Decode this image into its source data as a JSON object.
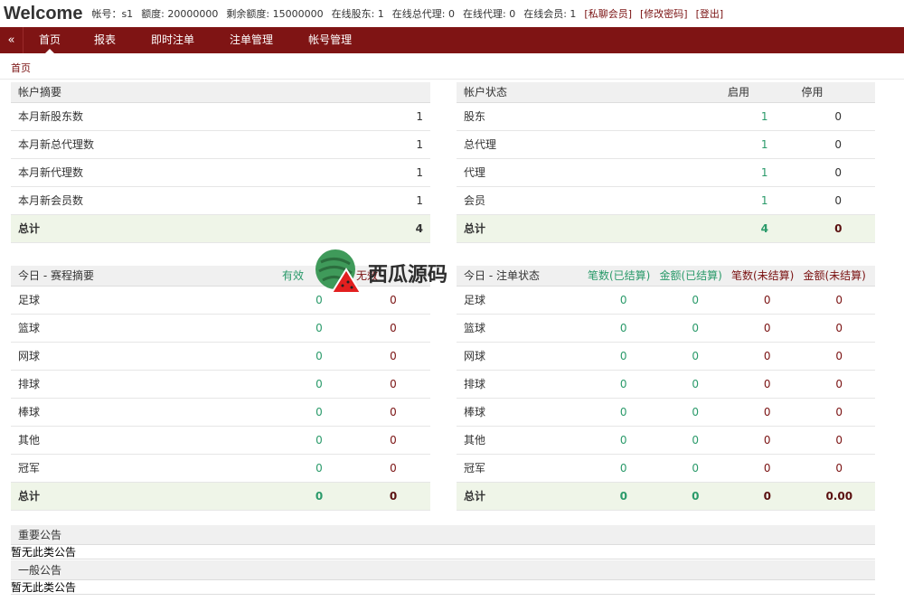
{
  "header": {
    "brand": "Welcome",
    "account": "帐号：s1",
    "credit": "额度: 20000000",
    "remaining": "剩余额度: 15000000",
    "online_shareholder": "在线股东: 1",
    "online_general_agent": "在线总代理: 0",
    "online_agent": "在线代理: 0",
    "online_member": "在线会员: 1",
    "link_chat": "[私聊会员]",
    "link_password": "[修改密码]",
    "link_logout": "[登出]"
  },
  "nav": {
    "collapse_icon": "«",
    "items": [
      "首页",
      "报表",
      "即时注单",
      "注单管理",
      "帐号管理"
    ]
  },
  "breadcrumb": "首页",
  "account_summary": {
    "title": "帐户摘要",
    "rows": [
      {
        "label": "本月新股东数",
        "value": "1"
      },
      {
        "label": "本月新总代理数",
        "value": "1"
      },
      {
        "label": "本月新代理数",
        "value": "1"
      },
      {
        "label": "本月新会员数",
        "value": "1"
      }
    ],
    "total": {
      "label": "总计",
      "value": "4"
    }
  },
  "account_status": {
    "title": "帐户状态",
    "col_enabled": "启用",
    "col_disabled": "停用",
    "rows": [
      {
        "label": "股东",
        "enabled": "1",
        "disabled": "0"
      },
      {
        "label": "总代理",
        "enabled": "1",
        "disabled": "0"
      },
      {
        "label": "代理",
        "enabled": "1",
        "disabled": "0"
      },
      {
        "label": "会员",
        "enabled": "1",
        "disabled": "0"
      }
    ],
    "total": {
      "label": "总计",
      "enabled": "4",
      "disabled": "0"
    }
  },
  "today_events": {
    "title": "今日 - 赛程摘要",
    "col1": "有效",
    "col2": "无效",
    "rows": [
      {
        "label": "足球",
        "a": "0",
        "b": "0"
      },
      {
        "label": "篮球",
        "a": "0",
        "b": "0"
      },
      {
        "label": "网球",
        "a": "0",
        "b": "0"
      },
      {
        "label": "排球",
        "a": "0",
        "b": "0"
      },
      {
        "label": "棒球",
        "a": "0",
        "b": "0"
      },
      {
        "label": "其他",
        "a": "0",
        "b": "0"
      },
      {
        "label": "冠军",
        "a": "0",
        "b": "0"
      }
    ],
    "total": {
      "label": "总计",
      "a": "0",
      "b": "0"
    }
  },
  "today_bets": {
    "title": "今日 - 注单状态",
    "col1": "笔数(已结算)",
    "col2": "金额(已结算)",
    "col3": "笔数(未结算)",
    "col4": "金额(未结算)",
    "rows": [
      {
        "label": "足球",
        "a": "0",
        "b": "0",
        "c": "0",
        "d": "0"
      },
      {
        "label": "篮球",
        "a": "0",
        "b": "0",
        "c": "0",
        "d": "0"
      },
      {
        "label": "网球",
        "a": "0",
        "b": "0",
        "c": "0",
        "d": "0"
      },
      {
        "label": "排球",
        "a": "0",
        "b": "0",
        "c": "0",
        "d": "0"
      },
      {
        "label": "棒球",
        "a": "0",
        "b": "0",
        "c": "0",
        "d": "0"
      },
      {
        "label": "其他",
        "a": "0",
        "b": "0",
        "c": "0",
        "d": "0"
      },
      {
        "label": "冠军",
        "a": "0",
        "b": "0",
        "c": "0",
        "d": "0"
      }
    ],
    "total": {
      "label": "总计",
      "a": "0",
      "b": "0",
      "c": "0",
      "d": "0.00"
    }
  },
  "notices": {
    "important_title": "重要公告",
    "important_body": "暂无此类公告",
    "general_title": "一般公告",
    "general_body": "暂无此类公告"
  },
  "watermark": {
    "text": "西瓜源码",
    "icon": "watermelon-icon"
  },
  "colors": {
    "nav_bg": "#7f1414",
    "link": "#7a1212",
    "green": "#2a9a6a",
    "total_bg": "#eff5e8"
  }
}
